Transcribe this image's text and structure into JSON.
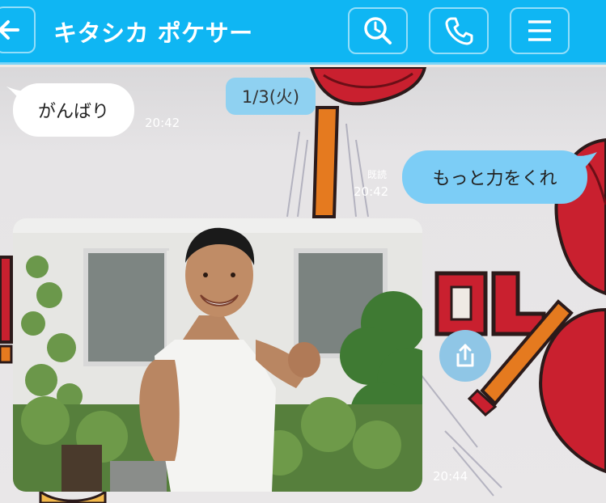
{
  "header": {
    "title": "キタシカ ポケサー",
    "back_icon": "back-arrow-icon",
    "search_icon": "search-icon",
    "call_icon": "phone-icon",
    "menu_icon": "menu-icon",
    "color": "#0fb6f3"
  },
  "chat": {
    "date_label": "1/3(火)",
    "messages": [
      {
        "side": "in",
        "text": "がんばり",
        "time": "20:42"
      },
      {
        "side": "out",
        "text": "もっと力をくれ",
        "time": "20:42",
        "read_label": "既読"
      },
      {
        "side": "in",
        "type": "photo",
        "time": "20:44",
        "share_icon": "share-icon"
      }
    ]
  }
}
